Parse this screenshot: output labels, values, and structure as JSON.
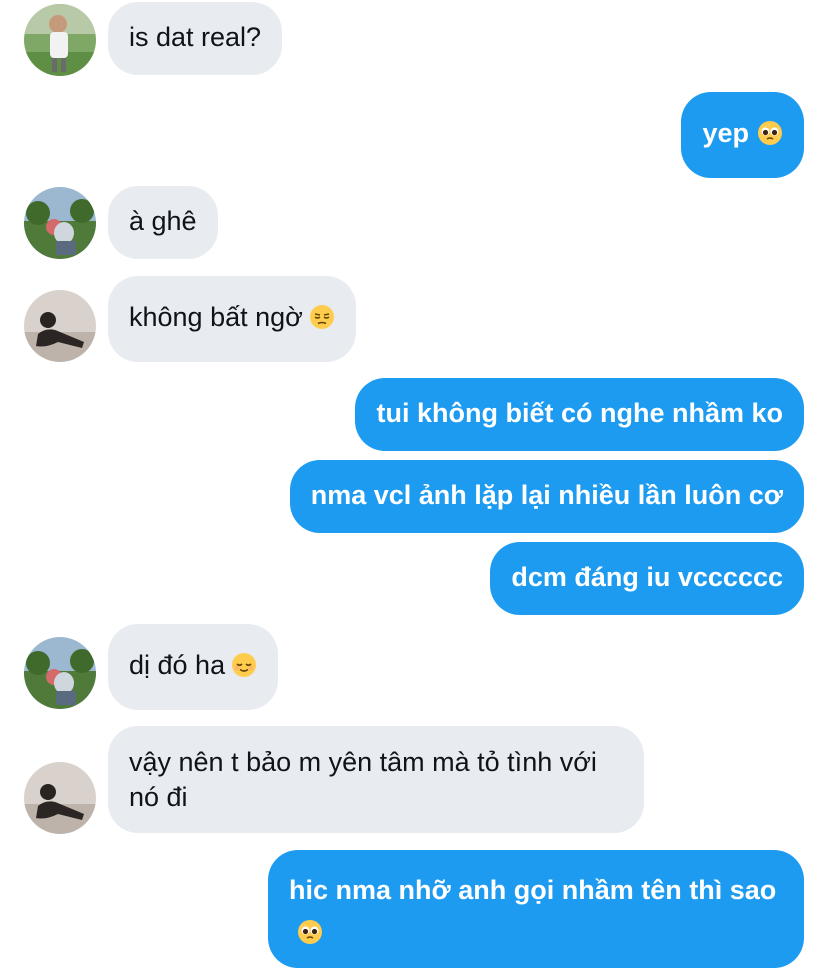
{
  "conversation": {
    "messages": [
      {
        "side": "in",
        "text": "is dat real?",
        "emoji": ""
      },
      {
        "side": "out",
        "text": "yep",
        "emoji": "pleading-face"
      },
      {
        "side": "in",
        "text": "à ghê",
        "emoji": ""
      },
      {
        "side": "in",
        "text": "không bất ngờ",
        "emoji": "unamused-face"
      },
      {
        "side": "out",
        "text": "tui không biết có nghe nhầm ko",
        "emoji": ""
      },
      {
        "side": "out",
        "text": "nma vcl ảnh lặp lại nhiều lần luôn cơ",
        "emoji": ""
      },
      {
        "side": "out",
        "text": "dcm đáng iu vcccccc",
        "emoji": ""
      },
      {
        "side": "in",
        "text": "dị đó ha",
        "emoji": "relieved-face"
      },
      {
        "side": "in",
        "text": "vậy nên t bảo m yên tâm mà tỏ tình với nó đi",
        "emoji": ""
      },
      {
        "side": "out",
        "text": "hic nma nhỡ anh gọi nhầm tên thì sao",
        "emoji": "pleading-face"
      }
    ]
  },
  "colors": {
    "incoming_bubble": "#e8ebef",
    "outgoing_bubble": "#1d9bf0",
    "incoming_text": "#0f1419",
    "outgoing_text": "#ffffff",
    "emoji_yellow": "#ffcc4d"
  }
}
